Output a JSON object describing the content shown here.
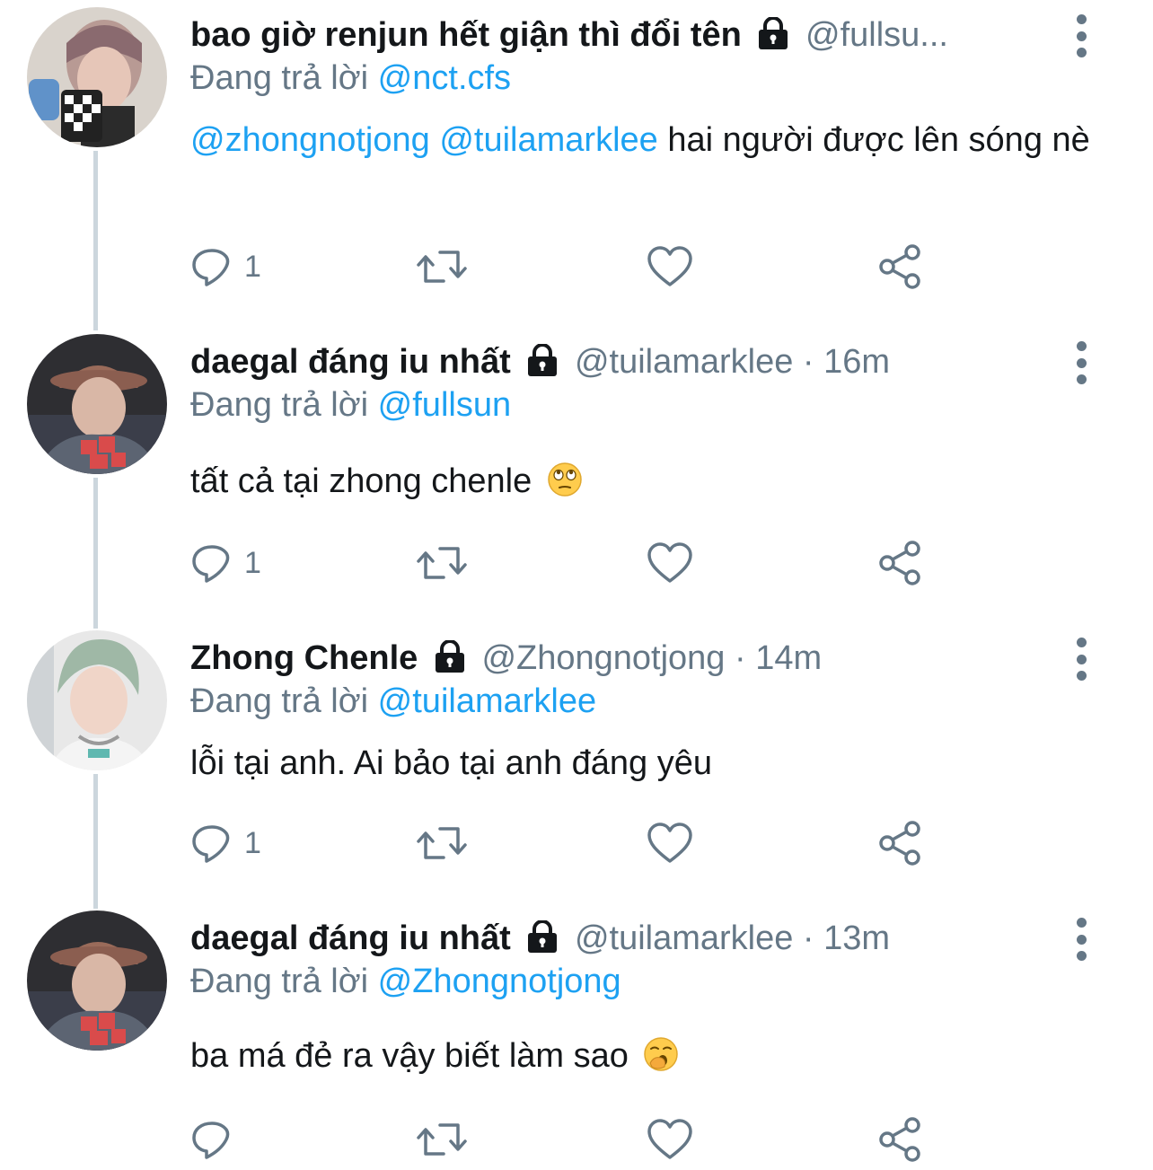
{
  "colors": {
    "text": "#14171a",
    "secondary": "#657786",
    "link": "#1da1f2",
    "thread_line": "#ccd6dd"
  },
  "tweets": [
    {
      "name": "bao giờ renjun hết giận thì đổi tên",
      "handle_time": "@fullsu...",
      "reply_prefix": "Đang trả lời",
      "reply_to": "@nct.cfs",
      "mention_1": "@zhongnotjong",
      "mention_2": "@tuilamarklee",
      "text": "hai người được lên sóng nè",
      "reply_count": "1",
      "locked_icon": "lock-icon"
    },
    {
      "name": "daegal đáng iu nhất",
      "handle_time": "@tuilamarklee · 16m",
      "reply_prefix": "Đang trả lời",
      "reply_to": "@fullsun",
      "text": "tất cả tại zhong chenle",
      "emoji": "eye-roll-emoji",
      "reply_count": "1"
    },
    {
      "name": "Zhong Chenle",
      "handle_time": "@Zhongnotjong · 14m",
      "reply_prefix": "Đang trả lời",
      "reply_to": "@tuilamarklee",
      "text": "lỗi tại anh. Ai bảo tại anh đáng yêu",
      "reply_count": "1"
    },
    {
      "name": "daegal đáng iu nhất",
      "handle_time": "@tuilamarklee · 13m",
      "reply_prefix": "Đang trả lời",
      "reply_to": "@Zhongnotjong",
      "text": "ba má đẻ ra vậy biết làm sao",
      "emoji": "yawning-emoji",
      "reply_count": ""
    }
  ]
}
